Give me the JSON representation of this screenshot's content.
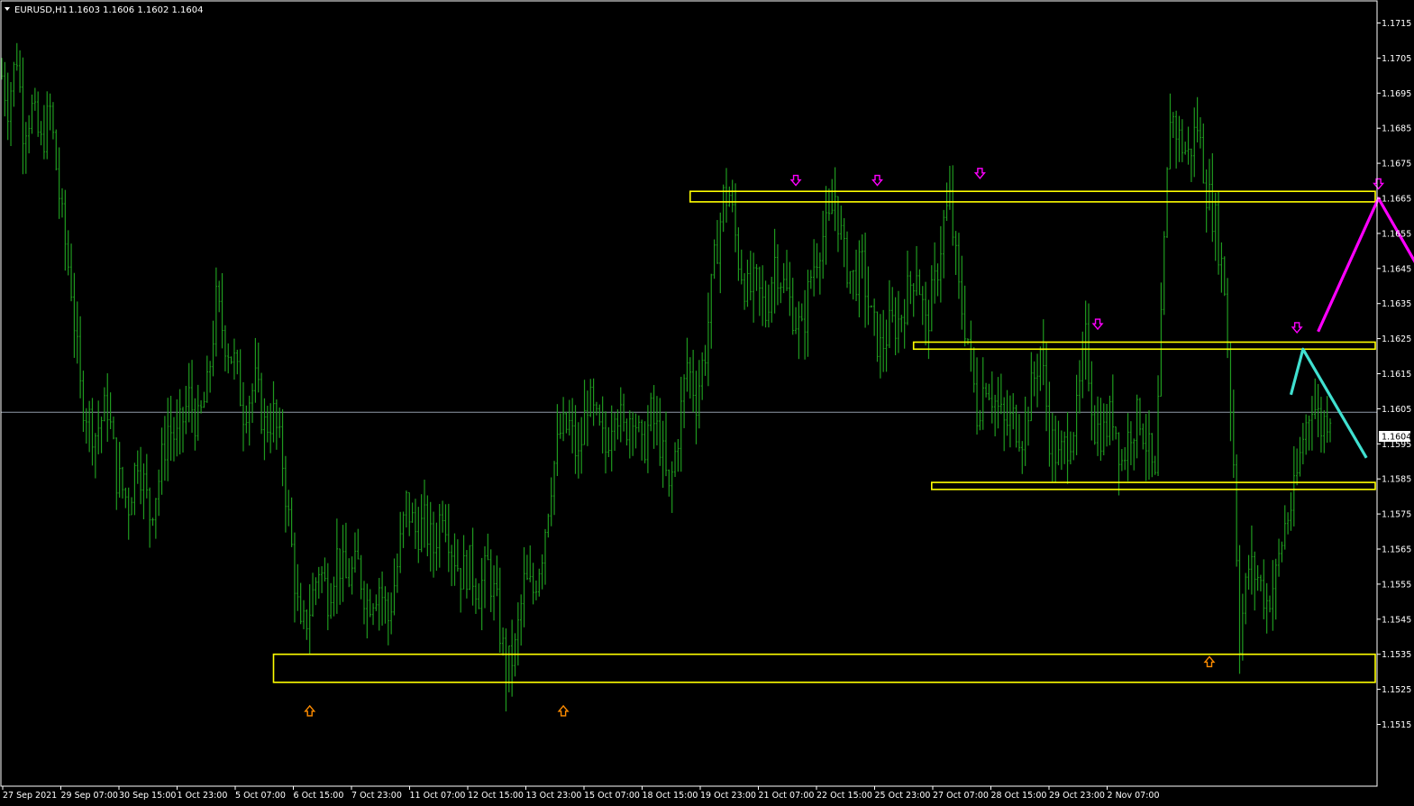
{
  "header": {
    "symbol": "EURUSD,H1",
    "ohlc": "1.1603 1.1606 1.1602 1.1604"
  },
  "colors": {
    "background": "#000000",
    "frame": "#ffffff",
    "candles": "#1f9a1f",
    "zones": "#ffff00",
    "projection_main": "#ff00ff",
    "projection_alt": "#40e0d0",
    "sell_arrows": "#ff00ff",
    "buy_arrows": "#ff8c00",
    "bid_line": "#8f9aa8"
  },
  "chart_data": {
    "type": "line",
    "title": "EURUSD,H1",
    "ylim": [
      1.1507,
      1.1722
    ],
    "y_ticks": [
      "1.1715",
      "1.1705",
      "1.1695",
      "1.1685",
      "1.1675",
      "1.1665",
      "1.1655",
      "1.1645",
      "1.1635",
      "1.1625",
      "1.1615",
      "1.1605",
      "1.1595",
      "1.1585",
      "1.1575",
      "1.1565",
      "1.1555",
      "1.1545",
      "1.1535",
      "1.1525",
      "1.1515"
    ],
    "x_ticks": [
      "27 Sep 2021",
      "29 Sep 07:00",
      "30 Sep 15:00",
      "1 Oct 23:00",
      "5 Oct 07:00",
      "6 Oct 15:00",
      "7 Oct 23:00",
      "11 Oct 07:00",
      "12 Oct 15:00",
      "13 Oct 23:00",
      "15 Oct 07:00",
      "18 Oct 15:00",
      "19 Oct 23:00",
      "21 Oct 07:00",
      "22 Oct 15:00",
      "25 Oct 23:00",
      "27 Oct 07:00",
      "28 Oct 15:00",
      "29 Oct 23:00",
      "2 Nov 07:00"
    ],
    "current_price": "1.1604",
    "price_path": [
      [
        0,
        1.17
      ],
      [
        2,
        1.1692
      ],
      [
        5,
        1.1706
      ],
      [
        7,
        1.1686
      ],
      [
        10,
        1.169
      ],
      [
        13,
        1.168
      ],
      [
        16,
        1.169
      ],
      [
        20,
        1.1658
      ],
      [
        23,
        1.164
      ],
      [
        26,
        1.161
      ],
      [
        29,
        1.1602
      ],
      [
        31,
        1.1598
      ],
      [
        35,
        1.1606
      ],
      [
        38,
        1.1586
      ],
      [
        42,
        1.1578
      ],
      [
        45,
        1.1592
      ],
      [
        49,
        1.1575
      ],
      [
        52,
        1.1585
      ],
      [
        55,
        1.16
      ],
      [
        58,
        1.1596
      ],
      [
        62,
        1.1608
      ],
      [
        65,
        1.16
      ],
      [
        68,
        1.161
      ],
      [
        71,
        1.1635
      ],
      [
        74,
        1.1625
      ],
      [
        77,
        1.1618
      ],
      [
        80,
        1.1605
      ],
      [
        84,
        1.1612
      ],
      [
        87,
        1.16
      ],
      [
        90,
        1.1603
      ],
      [
        93,
        1.159
      ],
      [
        96,
        1.1565
      ],
      [
        99,
        1.154
      ],
      [
        102,
        1.1548
      ],
      [
        105,
        1.156
      ],
      [
        108,
        1.1552
      ],
      [
        111,
        1.1563
      ],
      [
        114,
        1.1556
      ],
      [
        118,
        1.156
      ],
      [
        121,
        1.155
      ],
      [
        125,
        1.1555
      ],
      [
        128,
        1.1545
      ],
      [
        131,
        1.156
      ],
      [
        134,
        1.1578
      ],
      [
        137,
        1.157
      ],
      [
        140,
        1.1572
      ],
      [
        143,
        1.1565
      ],
      [
        146,
        1.1578
      ],
      [
        149,
        1.1566
      ],
      [
        152,
        1.1558
      ],
      [
        155,
        1.156
      ],
      [
        158,
        1.1553
      ],
      [
        161,
        1.156
      ],
      [
        164,
        1.1548
      ],
      [
        167,
        1.153
      ],
      [
        170,
        1.1536
      ],
      [
        173,
        1.1555
      ],
      [
        176,
        1.1553
      ],
      [
        179,
        1.1565
      ],
      [
        182,
        1.1585
      ],
      [
        185,
        1.1598
      ],
      [
        188,
        1.16
      ],
      [
        191,
        1.159
      ],
      [
        194,
        1.1608
      ],
      [
        197,
        1.16
      ],
      [
        200,
        1.1593
      ],
      [
        203,
        1.1608
      ],
      [
        206,
        1.1598
      ],
      [
        209,
        1.1606
      ],
      [
        212,
        1.1592
      ],
      [
        215,
        1.1603
      ],
      [
        218,
        1.1596
      ],
      [
        221,
        1.158
      ],
      [
        224,
        1.1598
      ],
      [
        227,
        1.1618
      ],
      [
        230,
        1.1608
      ],
      [
        233,
        1.1622
      ],
      [
        236,
        1.1646
      ],
      [
        239,
        1.1665
      ],
      [
        241,
        1.1666
      ],
      [
        244,
        1.1648
      ],
      [
        247,
        1.1638
      ],
      [
        250,
        1.164
      ],
      [
        253,
        1.1632
      ],
      [
        256,
        1.1648
      ],
      [
        259,
        1.164
      ],
      [
        262,
        1.1633
      ],
      [
        265,
        1.1626
      ],
      [
        268,
        1.1643
      ],
      [
        271,
        1.1653
      ],
      [
        274,
        1.1657
      ],
      [
        276,
        1.1666
      ],
      [
        279,
        1.1648
      ],
      [
        282,
        1.1642
      ],
      [
        285,
        1.1645
      ],
      [
        288,
        1.163
      ],
      [
        291,
        1.1622
      ],
      [
        294,
        1.1628
      ],
      [
        297,
        1.163
      ],
      [
        300,
        1.1638
      ],
      [
        303,
        1.1646
      ],
      [
        306,
        1.1628
      ],
      [
        309,
        1.164
      ],
      [
        312,
        1.1658
      ],
      [
        314,
        1.1664
      ],
      [
        317,
        1.1638
      ],
      [
        320,
        1.1625
      ],
      [
        323,
        1.1604
      ],
      [
        326,
        1.1614
      ],
      [
        329,
        1.1607
      ],
      [
        332,
        1.16
      ],
      [
        335,
        1.1602
      ],
      [
        338,
        1.1598
      ],
      [
        341,
        1.161
      ],
      [
        344,
        1.1622
      ],
      [
        347,
        1.1598
      ],
      [
        350,
        1.159
      ],
      [
        353,
        1.1596
      ],
      [
        356,
        1.1603
      ],
      [
        359,
        1.1624
      ],
      [
        362,
        1.16
      ],
      [
        365,
        1.1598
      ],
      [
        368,
        1.1604
      ],
      [
        371,
        1.159
      ],
      [
        374,
        1.16
      ],
      [
        377,
        1.1603
      ],
      [
        380,
        1.1592
      ],
      [
        382,
        1.1583
      ],
      [
        385,
        1.165
      ],
      [
        387,
        1.169
      ],
      [
        390,
        1.1682
      ],
      [
        393,
        1.1677
      ],
      [
        396,
        1.1686
      ],
      [
        399,
        1.1668
      ],
      [
        402,
        1.1658
      ],
      [
        405,
        1.164
      ],
      [
        408,
        1.159
      ],
      [
        410,
        1.154
      ],
      [
        413,
        1.156
      ],
      [
        416,
        1.1557
      ],
      [
        419,
        1.155
      ],
      [
        422,
        1.1557
      ],
      [
        425,
        1.1572
      ],
      [
        428,
        1.158
      ],
      [
        431,
        1.1597
      ],
      [
        434,
        1.1608
      ],
      [
        437,
        1.16
      ],
      [
        440,
        1.1605
      ]
    ],
    "zones": [
      {
        "from_bar": 228,
        "to_bar": 475,
        "low": 1.1664,
        "high": 1.1667
      },
      {
        "from_bar": 302,
        "to_bar": 463,
        "low": 1.1622,
        "high": 1.1624
      },
      {
        "from_bar": 308,
        "to_bar": 469,
        "low": 1.1582,
        "high": 1.1584
      },
      {
        "from_bar": 90,
        "to_bar": 460,
        "low": 1.1527,
        "high": 1.1535
      }
    ],
    "projections": [
      {
        "color": "#ff00ff",
        "points": [
          [
            436,
            1.1627
          ],
          [
            456,
            1.1665
          ],
          [
            510,
            1.1584
          ]
        ]
      },
      {
        "color": "#40e0d0",
        "points": [
          [
            427,
            1.1609
          ],
          [
            431,
            1.1622
          ],
          [
            452,
            1.1591
          ]
        ]
      }
    ],
    "sell_markers": [
      [
        263,
        1.167
      ],
      [
        290,
        1.167
      ],
      [
        324,
        1.1672
      ],
      [
        363,
        1.1629
      ],
      [
        429,
        1.1628
      ],
      [
        456,
        1.1669
      ]
    ],
    "buy_markers": [
      [
        102,
        1.1519
      ],
      [
        186,
        1.1519
      ],
      [
        400,
        1.1533
      ]
    ]
  }
}
